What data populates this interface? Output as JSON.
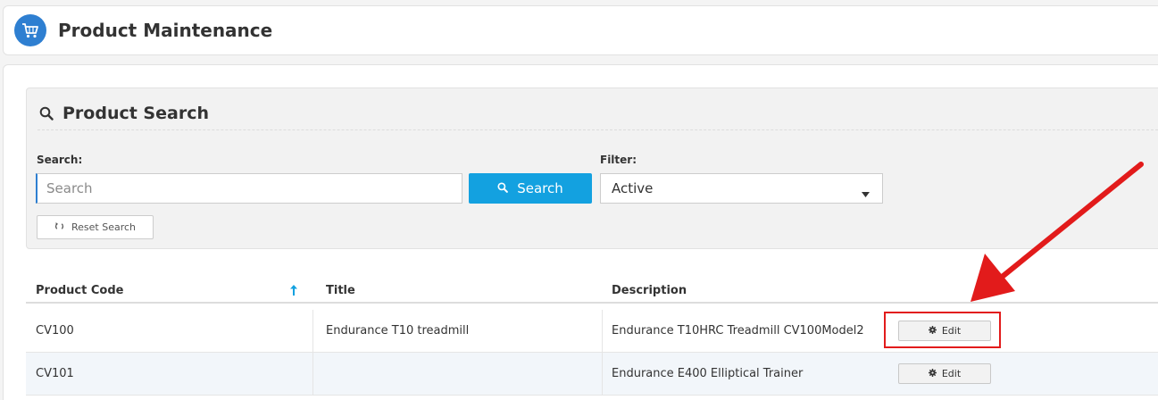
{
  "header": {
    "title": "Product Maintenance",
    "icon": "shopping-cart-icon"
  },
  "search_panel": {
    "title": "Product Search",
    "search_label": "Search:",
    "search_placeholder": "Search",
    "search_value": "",
    "search_button_label": "Search",
    "filter_label": "Filter:",
    "filter_selected": "Active",
    "reset_button_label": "Reset Search"
  },
  "table": {
    "columns": [
      "Product Code",
      "Title",
      "Description"
    ],
    "sort_column": "Product Code",
    "sort_direction": "ascending",
    "rows": [
      {
        "code": "CV100",
        "title": "Endurance T10 treadmill",
        "description": "Endurance T10HRC Treadmill CV100Model2",
        "action": "Edit"
      },
      {
        "code": "CV101",
        "title": "",
        "description": "Endurance E400 Elliptical Trainer",
        "action": "Edit"
      }
    ]
  },
  "colors": {
    "accent": "#13a1e0",
    "brand": "#2e7fd1",
    "annotation": "#e21b1b"
  }
}
